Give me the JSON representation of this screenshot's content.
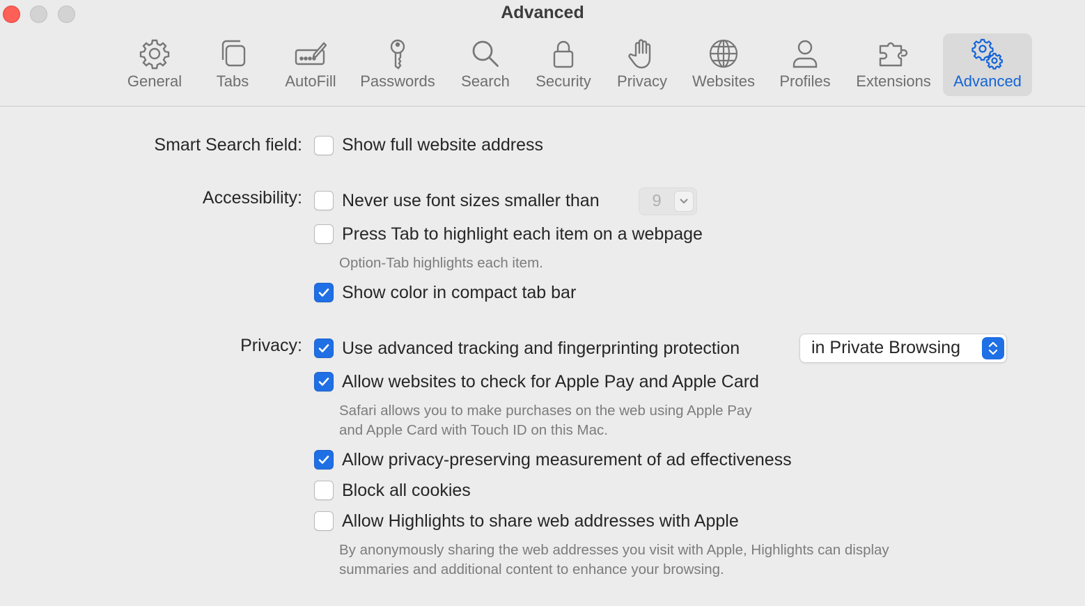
{
  "window": {
    "title": "Advanced"
  },
  "toolbar": {
    "tabs": [
      {
        "label": "General",
        "icon": "gear-icon"
      },
      {
        "label": "Tabs",
        "icon": "tabs-icon"
      },
      {
        "label": "AutoFill",
        "icon": "autofill-pencil-icon"
      },
      {
        "label": "Passwords",
        "icon": "key-icon"
      },
      {
        "label": "Search",
        "icon": "magnifier-icon"
      },
      {
        "label": "Security",
        "icon": "lock-icon"
      },
      {
        "label": "Privacy",
        "icon": "hand-icon"
      },
      {
        "label": "Websites",
        "icon": "globe-icon"
      },
      {
        "label": "Profiles",
        "icon": "person-icon"
      },
      {
        "label": "Extensions",
        "icon": "puzzle-icon"
      },
      {
        "label": "Advanced",
        "icon": "gears-icon",
        "selected": true
      }
    ]
  },
  "sections": {
    "smart_search": {
      "label": "Smart Search field:",
      "show_full_address": {
        "label": "Show full website address",
        "checked": false
      }
    },
    "accessibility": {
      "label": "Accessibility:",
      "min_font": {
        "label": "Never use font sizes smaller than",
        "checked": false,
        "value": "9"
      },
      "tab_highlight": {
        "label": "Press Tab to highlight each item on a webpage",
        "checked": false,
        "note": "Option-Tab highlights each item."
      },
      "compact_color": {
        "label": "Show color in compact tab bar",
        "checked": true
      }
    },
    "privacy": {
      "label": "Privacy:",
      "tracking": {
        "label": "Use advanced tracking and fingerprinting protection",
        "checked": true,
        "mode": "in Private Browsing"
      },
      "apple_pay": {
        "label": "Allow websites to check for Apple Pay and Apple Card",
        "checked": true,
        "note_line1": "Safari allows you to make purchases on the web using Apple Pay",
        "note_line2": "and Apple Card with Touch ID on this Mac."
      },
      "ad_measurement": {
        "label": "Allow privacy-preserving measurement of ad effectiveness",
        "checked": true
      },
      "block_cookies": {
        "label": "Block all cookies",
        "checked": false
      },
      "highlights": {
        "label": "Allow Highlights to share web addresses with Apple",
        "checked": false,
        "note_line1": "By anonymously sharing the web addresses you visit with Apple, Highlights can display",
        "note_line2": "summaries and additional content to enhance your browsing."
      }
    }
  },
  "colors": {
    "accent": "#1f6fe5",
    "close": "#fe5f57",
    "background": "#ececec"
  }
}
